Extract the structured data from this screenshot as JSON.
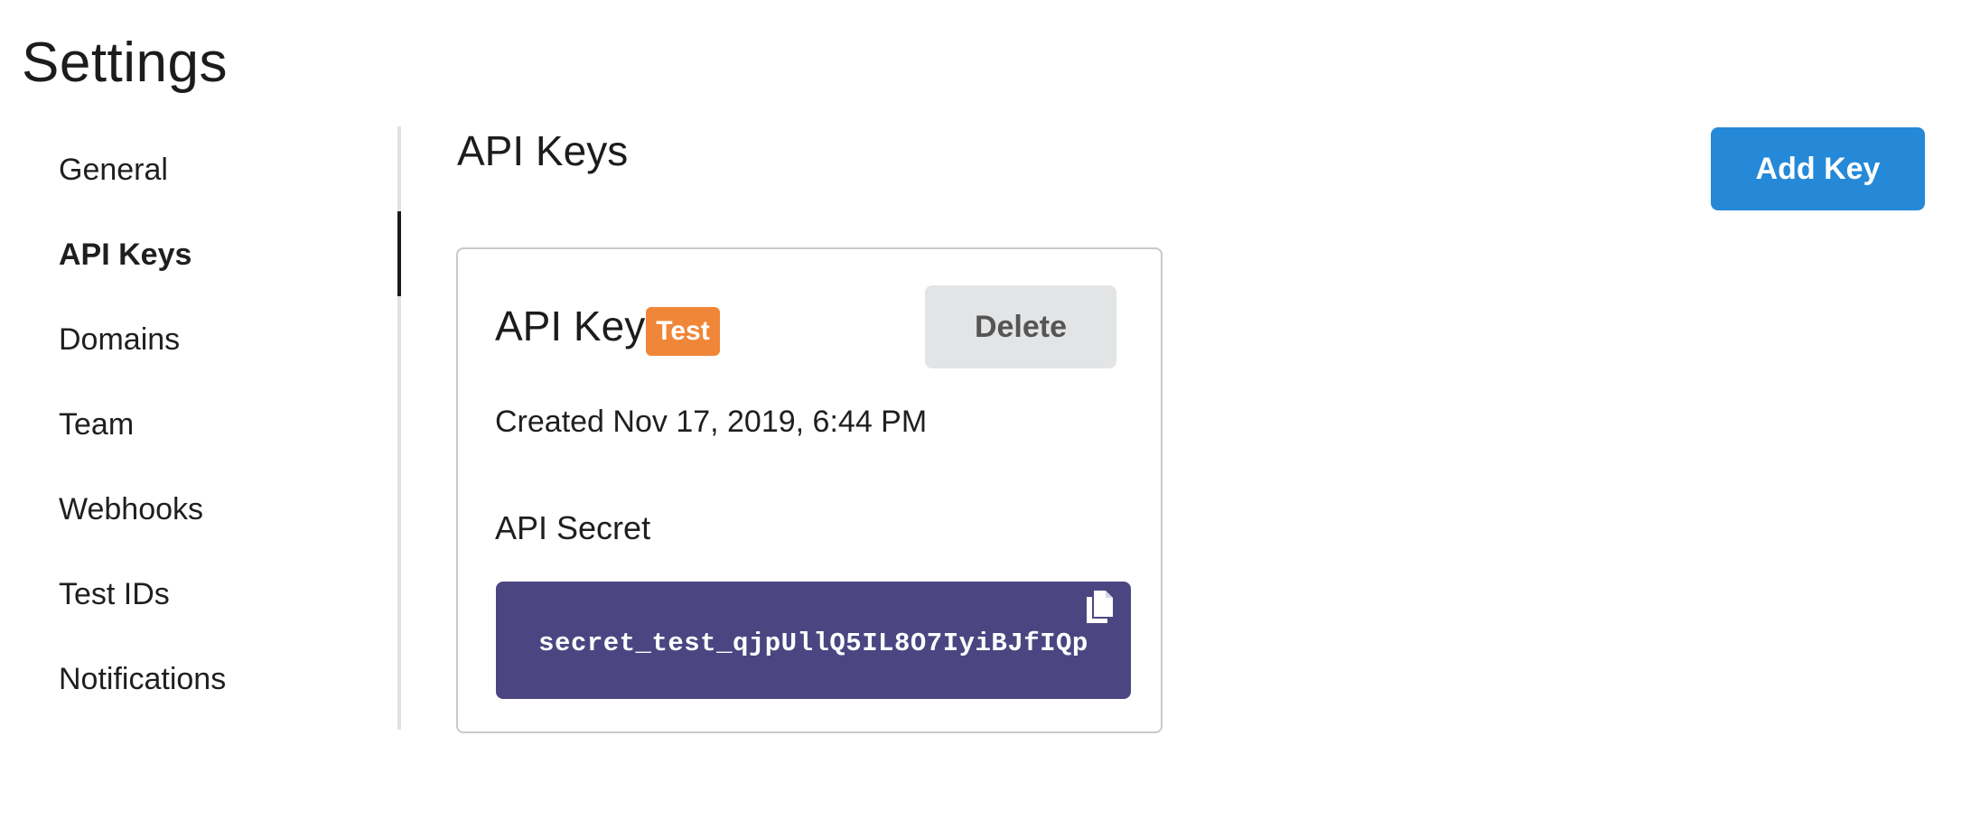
{
  "page": {
    "title": "Settings"
  },
  "sidebar": {
    "items": [
      {
        "label": "General",
        "active": false
      },
      {
        "label": "API Keys",
        "active": true
      },
      {
        "label": "Domains",
        "active": false
      },
      {
        "label": "Team",
        "active": false
      },
      {
        "label": "Webhooks",
        "active": false
      },
      {
        "label": "Test IDs",
        "active": false
      },
      {
        "label": "Notifications",
        "active": false
      }
    ]
  },
  "main": {
    "title": "API Keys",
    "add_button_label": "Add Key",
    "key_card": {
      "title": "API Key",
      "badge": "Test",
      "delete_label": "Delete",
      "created": "Created Nov 17, 2019, 6:44 PM",
      "secret_label": "API Secret",
      "secret_value": "secret_test_qjpUllQ5IL8O7IyiBJfIQp",
      "copy_icon": "copy-icon"
    }
  },
  "colors": {
    "accent": "#2589d8",
    "badge": "#f08637",
    "secret_bg": "#4b4681",
    "delete_bg": "#e3e4e6"
  }
}
